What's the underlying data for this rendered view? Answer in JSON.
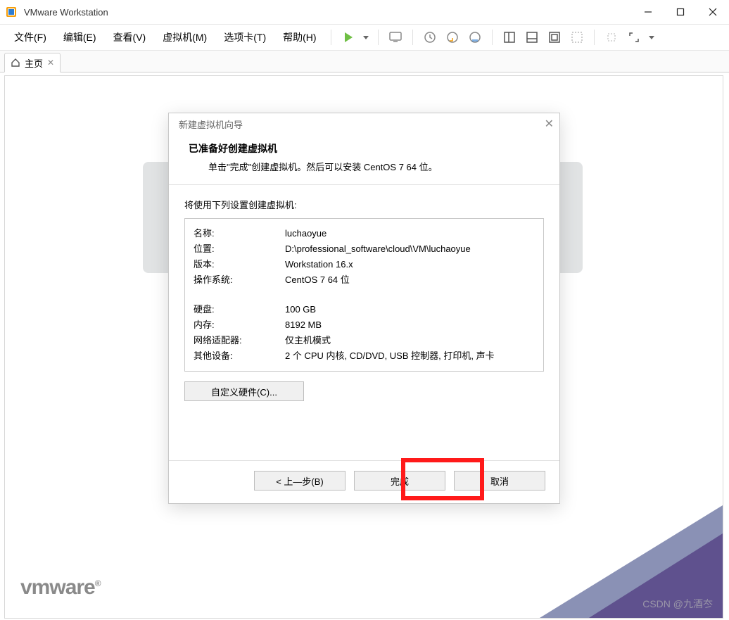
{
  "window": {
    "title": "VMware Workstation"
  },
  "menu": {
    "file": "文件(F)",
    "edit": "编辑(E)",
    "view": "查看(V)",
    "vm": "虚拟机(M)",
    "tabs": "选项卡(T)",
    "help": "帮助(H)"
  },
  "tab": {
    "home": "主页"
  },
  "logo": {
    "text": "vmware",
    "reg": "®"
  },
  "watermark": "CSDN @九酒冭",
  "dialog": {
    "title": "新建虚拟机向导",
    "heading": "已准备好创建虚拟机",
    "sub": "单击\"完成\"创建虚拟机。然后可以安装 CentOS 7 64 位。",
    "settings_intro": "将使用下列设置创建虚拟机:",
    "rows": {
      "name_k": "名称:",
      "name_v": "luchaoyue",
      "loc_k": "位置:",
      "loc_v": "D:\\professional_software\\cloud\\VM\\luchaoyue",
      "ver_k": "版本:",
      "ver_v": "Workstation 16.x",
      "os_k": "操作系统:",
      "os_v": "CentOS 7 64 位",
      "disk_k": "硬盘:",
      "disk_v": "100 GB",
      "mem_k": "内存:",
      "mem_v": "8192 MB",
      "net_k": "网络适配器:",
      "net_v": "仅主机模式",
      "other_k": "其他设备:",
      "other_v": "2 个 CPU 内核, CD/DVD, USB 控制器, 打印机, 声卡"
    },
    "custom_hw": "自定义硬件(C)...",
    "back": "< 上—步(B)",
    "finish": "完成",
    "cancel": "取消"
  }
}
